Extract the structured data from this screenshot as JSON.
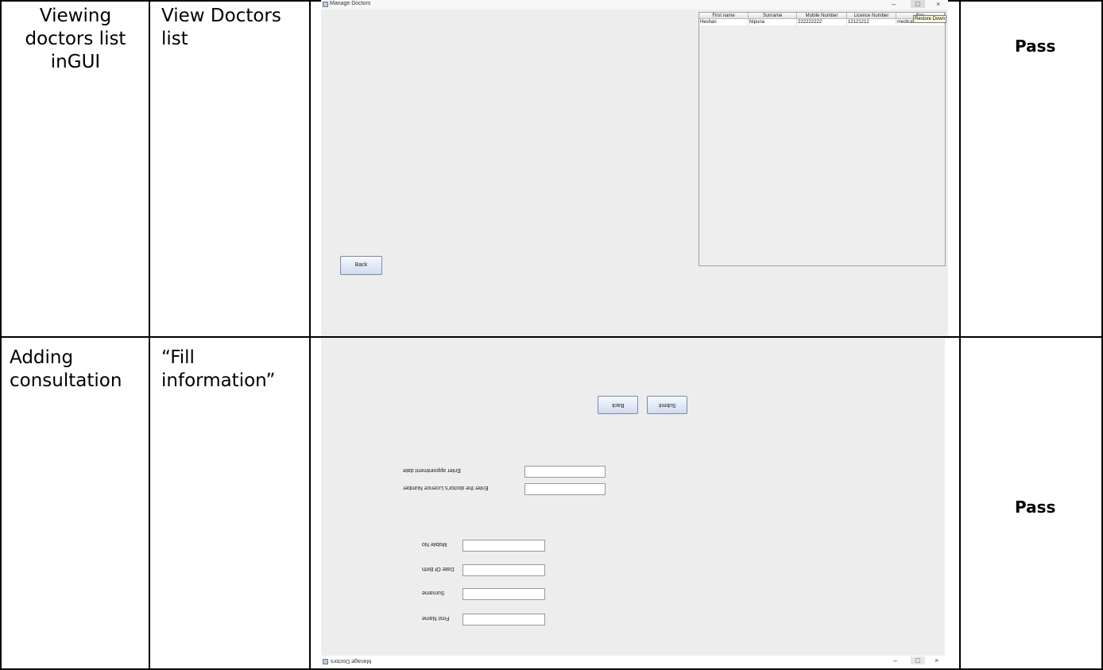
{
  "rows": [
    {
      "test": "Viewing doctors list inGUI",
      "action": "View Doctors list",
      "result": "Pass",
      "window": {
        "title": "Manage Doctors",
        "controls": {
          "minimize": "–",
          "maximize": "□",
          "close": "×"
        },
        "tooltip": "Restore Down",
        "table": {
          "columns": [
            "First name",
            "Surname",
            "Mobile Number",
            "Licence Number",
            "Spe"
          ],
          "rows": [
            [
              "Heshan",
              "Nipuna",
              "222222222",
              "12121212",
              "medical"
            ]
          ]
        },
        "back_label": "Back"
      }
    },
    {
      "test": "Adding consultation",
      "action": "“Fill information”",
      "result": "Pass",
      "window": {
        "title": "Manage Doctors",
        "controls": {
          "minimize": "–",
          "maximize": "□",
          "close": "×"
        },
        "back_label": "Back",
        "submit_label": "Submit",
        "fields": {
          "appointment_date": "Enter appointment date",
          "licence_number": "Enter the doctor's Licence Number",
          "mobile": "Mobile No",
          "dob": "Date Of Birth",
          "surname": "Surname",
          "first_name": "First Name"
        }
      }
    }
  ]
}
